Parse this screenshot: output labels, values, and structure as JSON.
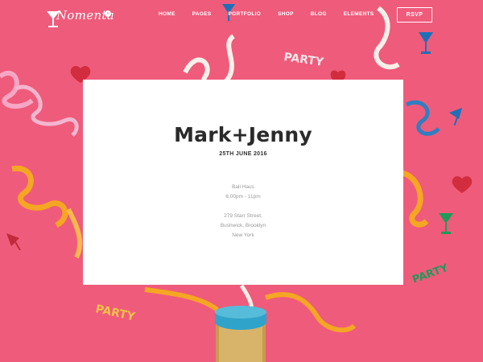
{
  "brand": {
    "name": "Nomenta",
    "badge": "®"
  },
  "nav": {
    "items": [
      {
        "label": "HOME"
      },
      {
        "label": "PAGES"
      },
      {
        "label": "PORTFOLIO"
      },
      {
        "label": "SHOP"
      },
      {
        "label": "BLOG"
      },
      {
        "label": "ELEMENTS"
      }
    ],
    "cta_label": "RSVP"
  },
  "invitation": {
    "names": "Mark+Jenny",
    "date": "25TH JUNE 2016",
    "venue": "Ball Haus",
    "time": "6.00pm - 11pm",
    "address_line1": "279 Starr Street,",
    "address_line2": "Bushwick, Brooklyn",
    "address_line3": "New York"
  },
  "decor": {
    "party_text": "PARTY",
    "colors": {
      "background": "#ef5b7b",
      "ribbon_pink": "#f7a6c4",
      "ribbon_orange": "#f5a623",
      "ribbon_white": "#f8f0e8",
      "ribbon_blue": "#2f7fc1",
      "heart_red": "#d22d3f",
      "glass_blue": "#1f6fb8",
      "glass_green": "#1e9a5a",
      "bottle_cap": "#2fa3c9",
      "bottle_gold": "#c89a4a"
    }
  }
}
